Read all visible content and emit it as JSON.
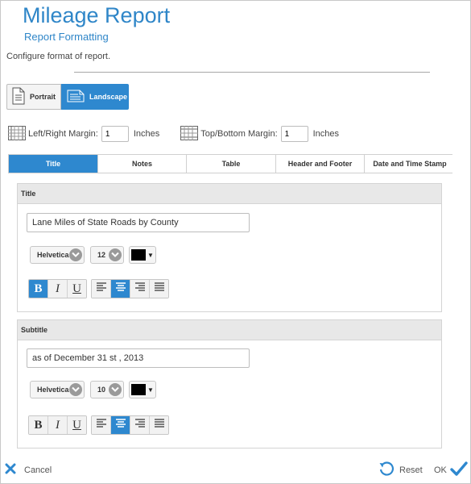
{
  "header": {
    "title": "Mileage Report",
    "subtitle": "Report Formatting",
    "description": "Configure format of report."
  },
  "orientation": {
    "portrait_label": "Portrait",
    "landscape_label": "Landscape",
    "selected": "Landscape"
  },
  "margins": {
    "lr_label": "Left/Right Margin:",
    "lr_value": "1",
    "lr_unit": "Inches",
    "tb_label": "Top/Bottom Margin:",
    "tb_value": "1",
    "tb_unit": "Inches"
  },
  "tabs": [
    {
      "label": "Title",
      "active": true
    },
    {
      "label": "Notes",
      "active": false
    },
    {
      "label": "Table",
      "active": false
    },
    {
      "label": "Header and Footer",
      "active": false
    },
    {
      "label": "Date and Time Stamp",
      "active": false
    }
  ],
  "title_section": {
    "heading": "Title",
    "text": "Lane Miles of State Roads by County",
    "font": "Helvetica",
    "size": "12",
    "color": "#000000",
    "bold": true,
    "italic": false,
    "underline": false,
    "align": "center"
  },
  "subtitle_section": {
    "heading": "Subtitle",
    "text": "as of December 31 st , 2013",
    "font": "Helvetica",
    "size": "10",
    "color": "#000000",
    "bold": false,
    "italic": false,
    "underline": false,
    "align": "center"
  },
  "format_buttons": {
    "bold": "B",
    "italic": "I",
    "underline": "U"
  },
  "footer": {
    "cancel_label": "Cancel",
    "reset_label": "Reset",
    "ok_label": "OK"
  },
  "colors": {
    "accent": "#2e88cf",
    "title": "#2f86c8"
  }
}
